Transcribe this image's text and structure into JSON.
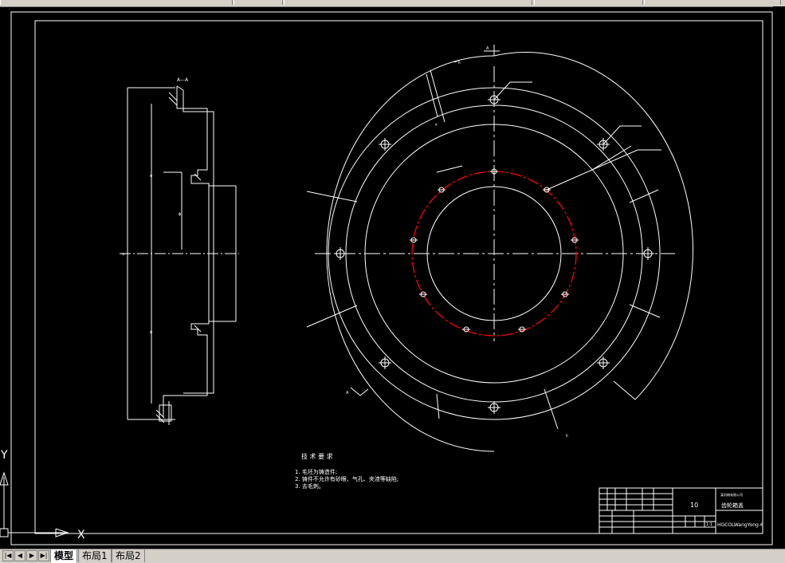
{
  "tabs": {
    "model": "模型",
    "layout1": "布局1",
    "layout2": "布局2"
  },
  "nav_icons": [
    "first-icon",
    "prev-icon",
    "next-icon",
    "last-icon"
  ],
  "ucs": {
    "x_label": "X",
    "y_label": "Y"
  },
  "section_view": {
    "title": "A—A"
  },
  "plan_view": {
    "section_mark": "A"
  },
  "tech_requirements": {
    "title": "技 术 要 求",
    "items": [
      "1. 毛坯为铸造件;",
      "2. 铸件不允许有砂眼、气孔、夹渣等缺陷;",
      "3. 去毛刺。"
    ]
  },
  "title_block": {
    "quantity": "10",
    "part_name": "齿轮箱盖",
    "drawing_no": "HGCOLWangYong-6",
    "scale": "1:1",
    "company": "某机械有限公司"
  },
  "colors": {
    "line": "#ffffff",
    "bolt_circle": "#ff0000",
    "background": "#000000"
  }
}
